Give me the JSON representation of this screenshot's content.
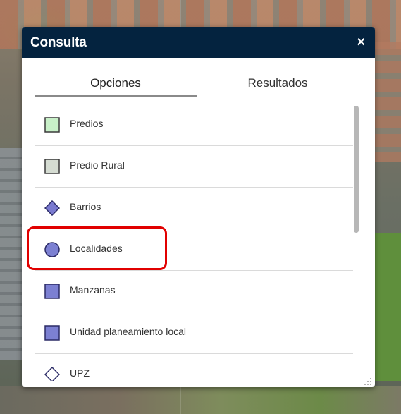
{
  "panel": {
    "title": "Consulta",
    "close_label": "×"
  },
  "tabs": [
    {
      "label": "Opciones",
      "active": true
    },
    {
      "label": "Resultados",
      "active": false
    }
  ],
  "layers": [
    {
      "label": "Predios",
      "symbol": "square",
      "fill": "#c8f0c8",
      "stroke": "#3a3a3a"
    },
    {
      "label": "Predio Rural",
      "symbol": "square",
      "fill": "#d5dcd2",
      "stroke": "#3a3a3a"
    },
    {
      "label": "Barrios",
      "symbol": "diamond",
      "fill": "#7a7ad0",
      "stroke": "#2b2b66"
    },
    {
      "label": "Localidades",
      "symbol": "circle",
      "fill": "#7c80d2",
      "stroke": "#2b2b66"
    },
    {
      "label": "Manzanas",
      "symbol": "square",
      "fill": "#7c80d2",
      "stroke": "#2b2b66"
    },
    {
      "label": "Unidad planeamiento local",
      "symbol": "square",
      "fill": "#7c80d2",
      "stroke": "#2b2b66"
    },
    {
      "label": "UPZ",
      "symbol": "diamond-outline",
      "fill": "#ffffff",
      "stroke": "#2b2b66"
    }
  ],
  "highlighted_item": "Localidades",
  "colors": {
    "header_bg": "#04233f",
    "highlight": "#e10000"
  }
}
